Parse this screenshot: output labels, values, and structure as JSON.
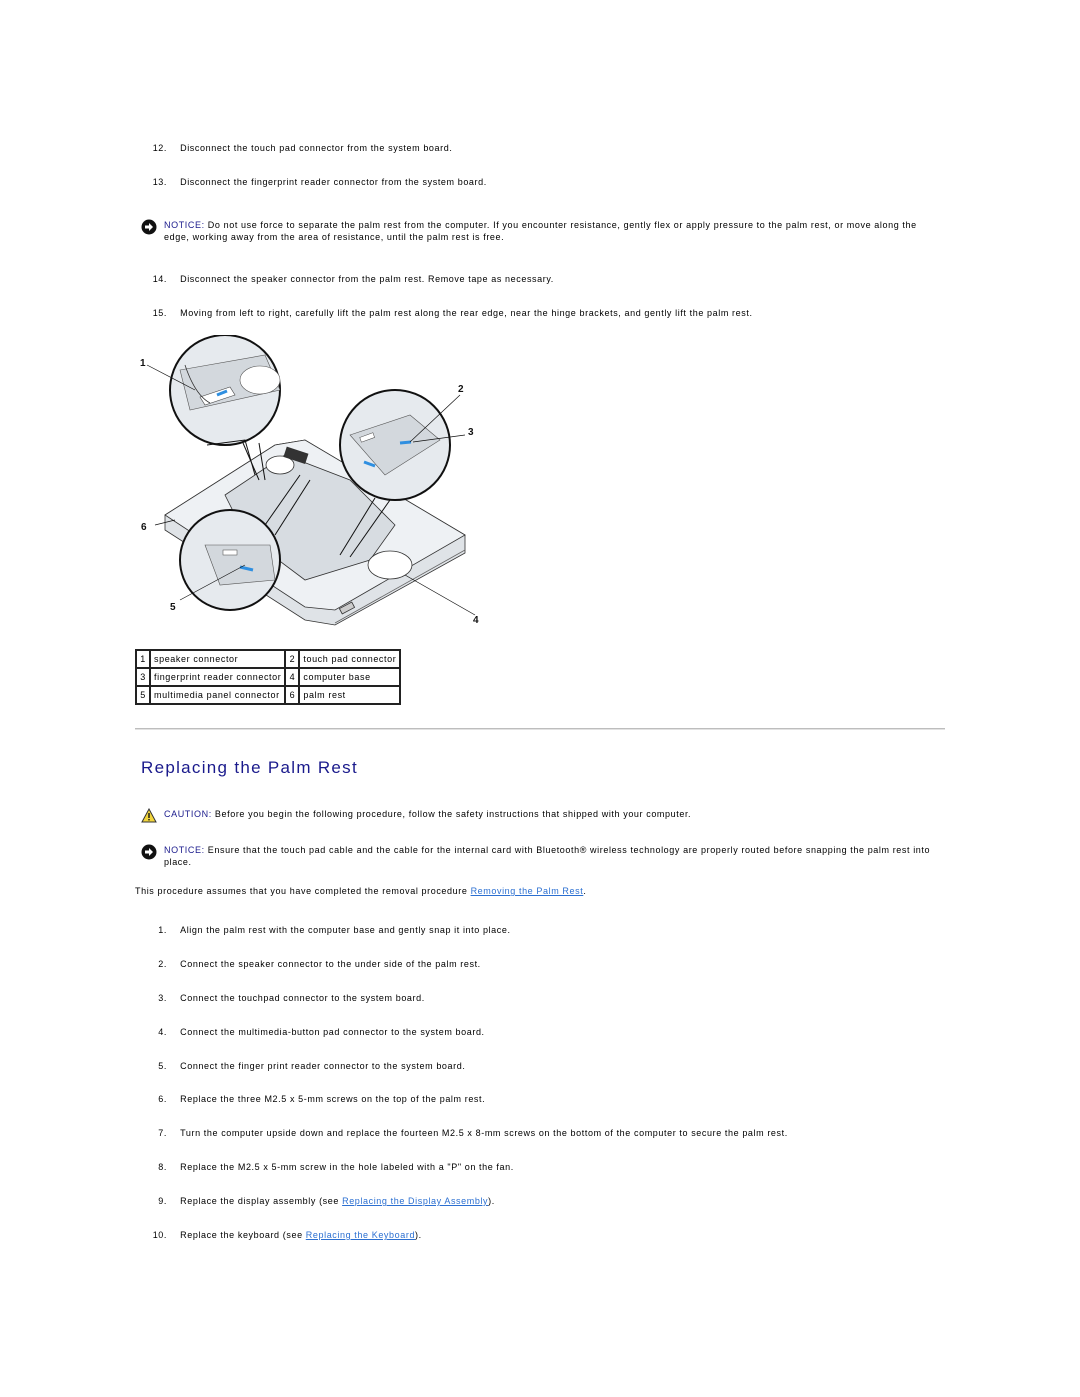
{
  "removal_steps": [
    {
      "num": "12.",
      "text": "Disconnect the touch pad connector from the system board."
    },
    {
      "num": "13.",
      "text": "Disconnect the fingerprint reader connector from the system board."
    },
    {
      "num": "14.",
      "text": "Disconnect the speaker connector from the palm rest. Remove tape as necessary."
    },
    {
      "num": "15.",
      "text": "Moving from left to right, carefully lift the palm rest along the rear edge, near the hinge brackets, and gently lift the palm rest."
    }
  ],
  "notice_1": {
    "icon": "notice-arrow-icon",
    "label": "NOTICE:",
    "text": " Do not use force to separate the palm rest from the computer. If you encounter resistance, gently flex or apply pressure to the palm rest, or move along the edge, working away from the area of resistance, until the palm rest is free."
  },
  "diagram": {
    "callouts": [
      "1",
      "2",
      "3",
      "4",
      "5",
      "6"
    ],
    "accent_color": "#2f8fe0"
  },
  "legend": [
    [
      {
        "num": "1",
        "label": "speaker connector"
      },
      {
        "num": "2",
        "label": "touch pad connector"
      }
    ],
    [
      {
        "num": "3",
        "label": "fingerprint reader connector"
      },
      {
        "num": "4",
        "label": "computer base"
      }
    ],
    [
      {
        "num": "5",
        "label": "multimedia panel connector"
      },
      {
        "num": "6",
        "label": "palm rest"
      }
    ]
  ],
  "section": {
    "title": "Replacing the Palm Rest",
    "title_color": "#1a1a8c"
  },
  "caution": {
    "icon": "caution-triangle-icon",
    "label": "CAUTION:",
    "text": " Before you begin the following procedure, follow the safety instructions that shipped with your computer."
  },
  "notice_2": {
    "icon": "notice-arrow-icon",
    "label": "NOTICE:",
    "text": " Ensure that the touch pad cable and the cable for the internal card with Bluetooth® wireless technology are properly routed before snapping the palm rest into place."
  },
  "intro": {
    "text": "This procedure assumes that you have completed the removal procedure ",
    "link": "Removing the Palm Rest",
    "suffix": "."
  },
  "replace_steps": [
    {
      "num": "1.",
      "text": "Align the palm rest with the computer base and gently snap it into place."
    },
    {
      "num": "2.",
      "text": "Connect the speaker connector to the under side of the palm rest."
    },
    {
      "num": "3.",
      "text": "Connect the touchpad connector to the system board."
    },
    {
      "num": "4.",
      "text": "Connect the multimedia-button pad connector to the system board."
    },
    {
      "num": "5.",
      "text": "Connect the finger print reader connector to the system board."
    },
    {
      "num": "6.",
      "text": "Replace the three M2.5 x 5-mm screws on the top of the palm rest."
    },
    {
      "num": "7.",
      "text": "Turn the computer upside down and replace the fourteen M2.5 x 8-mm screws on the bottom of the computer to secure the palm rest."
    },
    {
      "num": "8.",
      "text": "Replace the M2.5 x 5-mm screw in the hole labeled with a \"P\" on the fan."
    },
    {
      "num": "9.",
      "text": "Replace the display assembly (see ",
      "link": "Replacing the Display Assembly",
      "suffix": ")."
    },
    {
      "num": "10.",
      "text": "Replace the keyboard (see ",
      "link": "Replacing the Keyboard",
      "suffix": ")."
    }
  ],
  "colors": {
    "link": "#2b6fd1",
    "label": "#1a1a8c",
    "rule": "#bdbdbd"
  }
}
